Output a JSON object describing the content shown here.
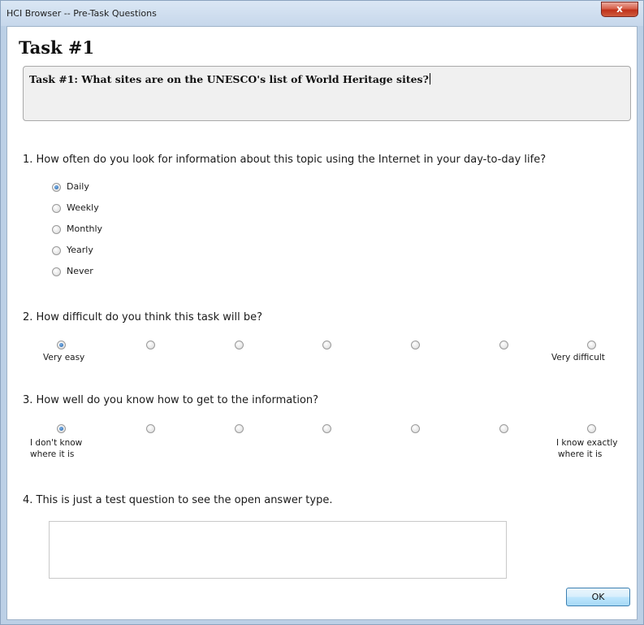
{
  "window": {
    "title": "HCI Browser -- Pre-Task Questions",
    "close_label": "x"
  },
  "task": {
    "title": "Task #1",
    "description": "Task #1: What sites are on the UNESCO's list of World Heritage sites?"
  },
  "q1": {
    "text": "1. How often do you look for information about this topic using the Internet in your day-to-day life?",
    "options": [
      "Daily",
      "Weekly",
      "Monthly",
      "Yearly",
      "Never"
    ],
    "selected": "Daily"
  },
  "q2": {
    "text": "2. How difficult do you think this task will be?",
    "min_label": "Very easy",
    "max_label": "Very difficult",
    "scale_points": 7,
    "selected_index": 0
  },
  "q3": {
    "text": "3. How well do you know how to get to the information?",
    "min_label_line1": "I don't know",
    "min_label_line2": "where it is",
    "max_label_line1": "I know exactly",
    "max_label_line2": "where it is",
    "scale_points": 7,
    "selected_index": 0
  },
  "q4": {
    "text": "4. This is just a test question to see the open answer type.",
    "answer_value": ""
  },
  "buttons": {
    "ok_label": "OK"
  },
  "colors": {
    "title_bar": "#c6d7eb",
    "close_button": "#c0321a",
    "radio_selected": "#1f5fa8",
    "ok_border": "#3c7fb1"
  }
}
